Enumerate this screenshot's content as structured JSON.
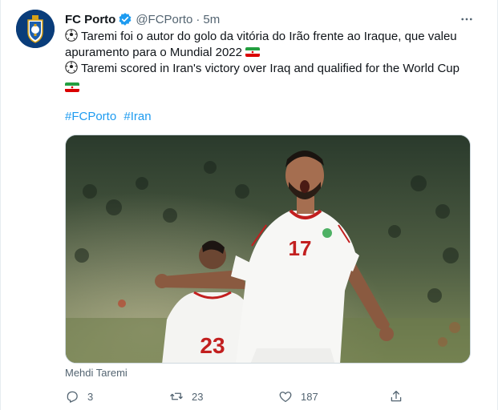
{
  "tweet": {
    "display_name": "FC Porto",
    "handle": "@FCPorto",
    "separator": "·",
    "timestamp": "5m",
    "text_pt_line1": "Taremi foi o autor do golo da vitória do Irão frente ao Iraque, que valeu",
    "text_pt_line2": "apuramento para o Mundial 2022",
    "text_en_line1": "Taremi scored in Iran's victory over Iraq and qualified for the World Cup",
    "hashtags": [
      "#FCPorto",
      "#Iran"
    ],
    "media_caption": "Mehdi Taremi",
    "jersey_numbers": [
      "17",
      "23"
    ]
  },
  "actions": {
    "reply_count": "3",
    "retweet_count": "23",
    "like_count": "187"
  },
  "icons": {
    "verified": "verified-badge-icon",
    "more": "more-options-icon",
    "ball": "soccer-ball-emoji",
    "flag": "iran-flag-emoji",
    "reply": "reply-icon",
    "retweet": "retweet-icon",
    "like": "heart-icon",
    "share": "share-icon"
  },
  "colors": {
    "accent": "#1d9bf0",
    "secondary_text": "#536471",
    "primary_text": "#0f1419"
  }
}
